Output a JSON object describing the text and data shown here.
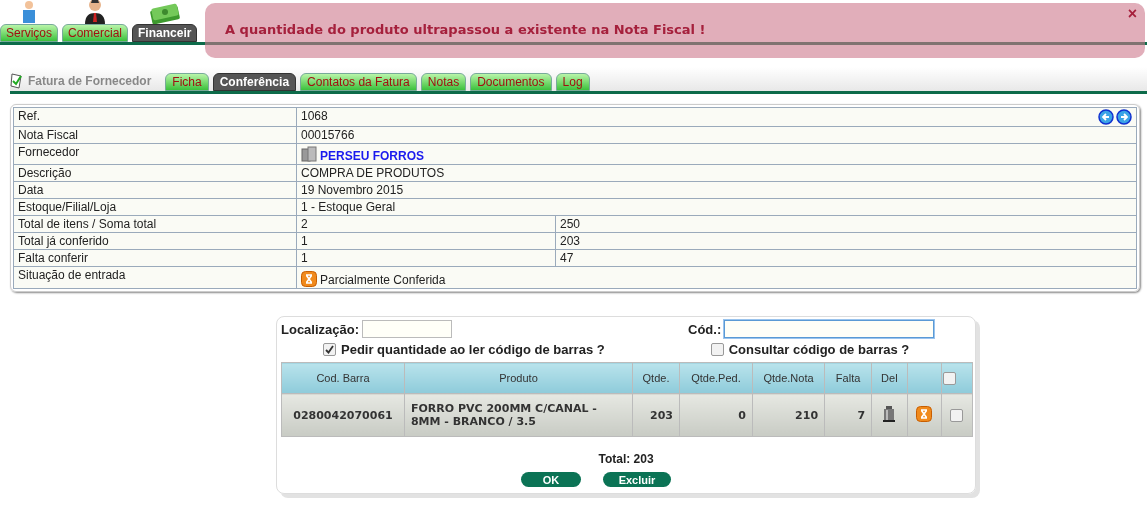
{
  "top_nav": {
    "tabs": [
      {
        "label": "Serviços",
        "selected": false
      },
      {
        "label": "Comercial",
        "selected": false
      },
      {
        "label": "Financeir",
        "selected": true
      }
    ]
  },
  "alert": {
    "message": "A quantidade do produto ultrapassou a existente na Nota Fiscal !",
    "close": "×"
  },
  "page": {
    "title": "Fatura de Fornecedor",
    "tabs": [
      {
        "label": "Ficha",
        "selected": false
      },
      {
        "label": "Conferência",
        "selected": true
      },
      {
        "label": "Contatos da Fatura",
        "selected": false
      },
      {
        "label": "Notas",
        "selected": false
      },
      {
        "label": "Documentos",
        "selected": false
      },
      {
        "label": "Log",
        "selected": false
      }
    ]
  },
  "details": {
    "rows": [
      {
        "label": "Ref.",
        "value": "1068",
        "kind": "nav"
      },
      {
        "label": "Nota Fiscal",
        "value": "00015766",
        "kind": "text"
      },
      {
        "label": "Fornecedor",
        "value": "PERSEU FORROS",
        "kind": "link"
      },
      {
        "label": "Descrição",
        "value": "COMPRA DE PRODUTOS",
        "kind": "text"
      },
      {
        "label": "Data",
        "value": "19 Novembro 2015",
        "kind": "text"
      },
      {
        "label": "Estoque/Filial/Loja",
        "value": "1 - Estoque Geral",
        "kind": "text"
      },
      {
        "label": "Total de itens / Soma total",
        "value": "2",
        "value_2": "250",
        "kind": "split"
      },
      {
        "label": "Total já conferido",
        "value": "1",
        "value_2": "203",
        "kind": "split"
      },
      {
        "label": "Falta conferir",
        "value": "1",
        "value_2": "47",
        "kind": "split"
      },
      {
        "label": "Situação de entrada",
        "value": "Parcialmente Conferida",
        "kind": "status"
      }
    ]
  },
  "conference": {
    "location_label": "Localização:",
    "code_label": "Cód.:",
    "code_focused": true,
    "options": [
      {
        "label": "Pedir quantidade ao ler código de barras ?",
        "checked": true
      },
      {
        "label": "Consultar código de barras ?",
        "checked": false
      }
    ],
    "table": {
      "columns": [
        "Cod. Barra",
        "Produto",
        "Qtde.",
        "Qtde.Ped.",
        "Qtde.Nota",
        "Falta",
        "Del"
      ],
      "select_all_checked": false,
      "rows": [
        {
          "cells": [
            "0280042070061",
            "FORRO PVC 200MM C/CANAL - 8MM - BRANCO / 3.5",
            "203",
            "0",
            "210",
            "7"
          ],
          "checked": false
        }
      ]
    },
    "total": "Total: 203",
    "buttons": [
      "OK",
      "Excluir"
    ]
  }
}
